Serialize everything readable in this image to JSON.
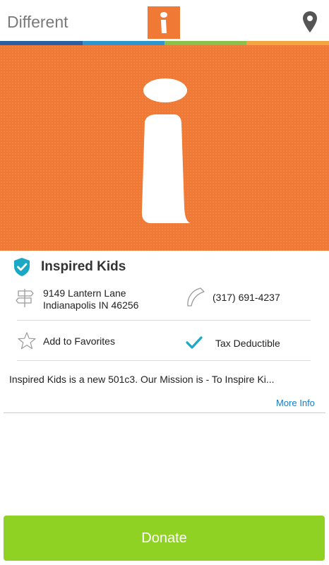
{
  "header": {
    "title": "Different",
    "logo_letter": "i",
    "location_icon": "map-pin-icon"
  },
  "colors": {
    "brand_orange": "#f07a35",
    "stripe": [
      "#2b5fa3",
      "#2f95cf",
      "#8bc04d",
      "#f2a541"
    ],
    "verified_teal": "#1aa8c4",
    "donate_green": "#8fd224",
    "link_blue": "#1a7bc2"
  },
  "hero": {
    "letter": "i"
  },
  "organization": {
    "name": "Inspired Kids",
    "verified_icon": "verified-shield-icon",
    "address_line1": "9149 Lantern Lane",
    "address_line2": "Indianapolis IN 46256",
    "phone": "(317) 691-4237",
    "favorites_label": "Add to Favorites",
    "tax_label": "Tax Deductible",
    "description": "Inspired Kids is a new 501c3.  Our Mission is - To Inspire Ki...",
    "more_info": "More Info"
  },
  "actions": {
    "donate_label": "Donate"
  }
}
